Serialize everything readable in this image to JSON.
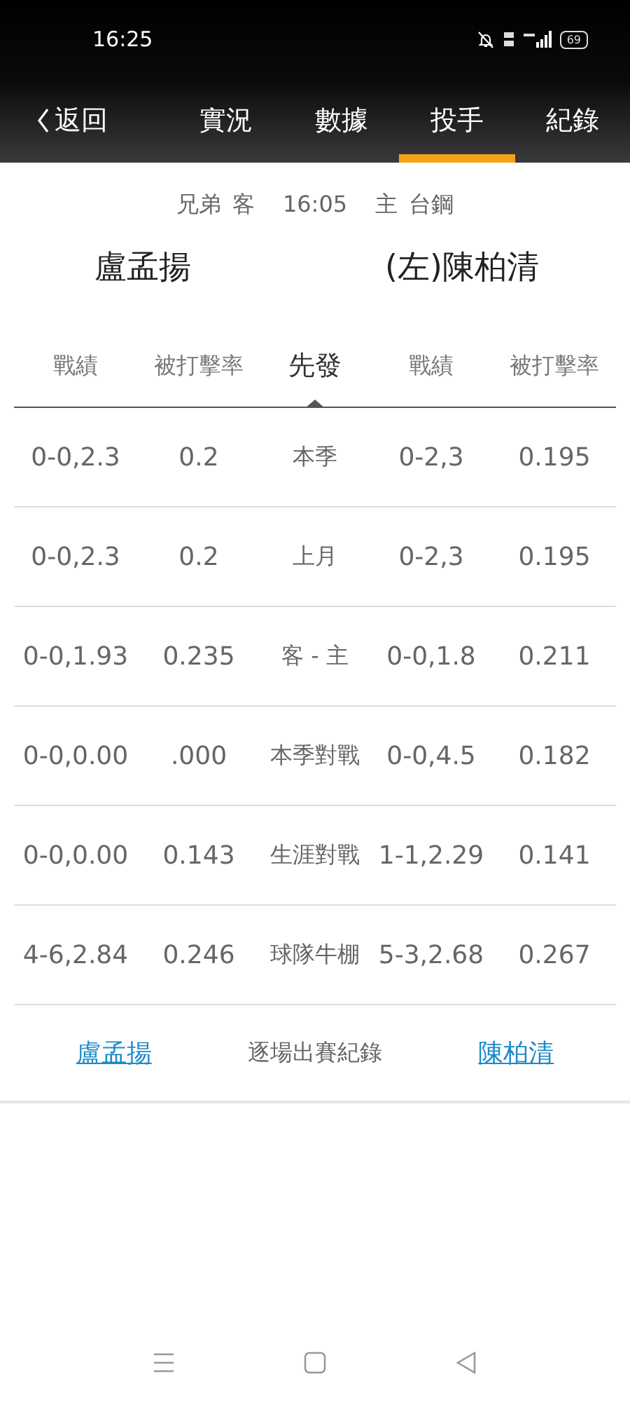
{
  "status_bar": {
    "time": "16:25",
    "battery": "69"
  },
  "nav": {
    "back": "返回",
    "tabs": [
      {
        "label": "實況",
        "selected": false
      },
      {
        "label": "數據",
        "selected": false
      },
      {
        "label": "投手",
        "selected": true
      },
      {
        "label": "紀錄",
        "selected": false
      }
    ]
  },
  "matchup": {
    "away_team": "兄弟",
    "away_tag": "客",
    "time": "16:05",
    "home_tag": "主",
    "home_team": "台鋼",
    "away_pitcher": "盧孟揚",
    "home_pitcher": "(左)陳柏清"
  },
  "table": {
    "columns": [
      {
        "label": "戰績",
        "selected": false
      },
      {
        "label": "被打擊率",
        "selected": false
      },
      {
        "label": "先發",
        "selected": true
      },
      {
        "label": "戰績",
        "selected": false
      },
      {
        "label": "被打擊率",
        "selected": false
      }
    ],
    "rows": [
      [
        "0-0,2.3",
        "0.2",
        "本季",
        "0-2,3",
        "0.195"
      ],
      [
        "0-0,2.3",
        "0.2",
        "上月",
        "0-2,3",
        "0.195"
      ],
      [
        "0-0,1.93",
        "0.235",
        "客 - 主",
        "0-0,1.8",
        "0.211"
      ],
      [
        "0-0,0.00",
        ".000",
        "本季對戰",
        "0-0,4.5",
        "0.182"
      ],
      [
        "0-0,0.00",
        "0.143",
        "生涯對戰",
        "1-1,2.29",
        "0.141"
      ],
      [
        "4-6,2.84",
        "0.246",
        "球隊牛棚",
        "5-3,2.68",
        "0.267"
      ]
    ]
  },
  "game_log": {
    "away_link": "盧孟揚",
    "label": "逐場出賽紀錄",
    "home_link": "陳柏清"
  }
}
